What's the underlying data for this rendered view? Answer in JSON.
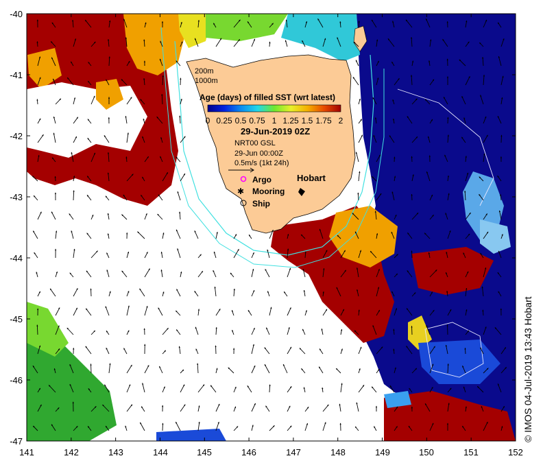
{
  "map": {
    "lon_ticks": [
      "141",
      "142",
      "143",
      "144",
      "145",
      "146",
      "147",
      "148",
      "149",
      "150",
      "151",
      "152"
    ],
    "lat_ticks": [
      "-40",
      "-41",
      "-42",
      "-43",
      "-44",
      "-45",
      "-46",
      "-47"
    ],
    "lon_range": [
      141,
      152
    ],
    "lat_range": [
      -47,
      -40
    ]
  },
  "contours": {
    "label_200": "200m",
    "label_1000": "1000m"
  },
  "legend": {
    "title": "Age (days) of filled SST (wrt latest)",
    "scale_labels": [
      "0",
      "0.25",
      "0.5",
      "0.75",
      "1",
      "1.25",
      "1.5",
      "1.75",
      "2"
    ],
    "date": "29-Jun-2019 02Z",
    "product": "NRT00 GSL",
    "product_time": "29-Jun 00:00Z",
    "vector_scale": "0.5m/s (1kt 24h)",
    "argo": "Argo",
    "mooring": "Mooring",
    "ship": "Ship",
    "city": "Hobart"
  },
  "credit": "© IMOS 04-Jul-2019 13:43 Hobart",
  "colors": {
    "land": "#fccb96",
    "ocean_blank": "#ffffff",
    "age_ramp": [
      "#00008c",
      "#0022e0",
      "#0a8cf0",
      "#22d8e8",
      "#6ee830",
      "#e8f02a",
      "#f5b000",
      "#e84a00",
      "#a00000"
    ],
    "bathy_200": "#40e0e0",
    "bathy_1000": "#e8e8ff"
  }
}
